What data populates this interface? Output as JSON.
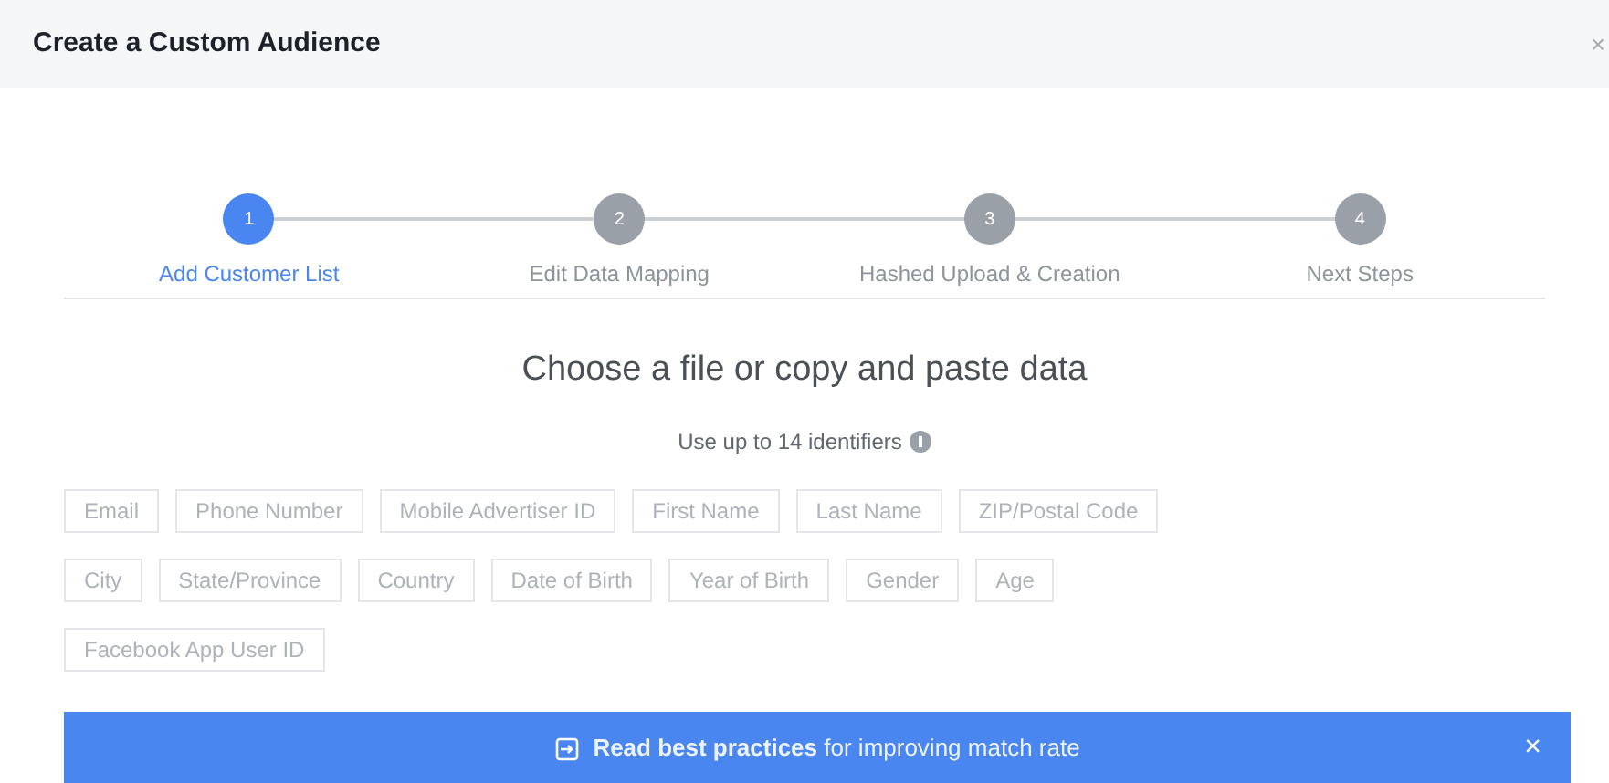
{
  "window": {
    "title": "Create a Custom Audience",
    "close": "×"
  },
  "steps": [
    {
      "number": "1",
      "label": "Add Customer List",
      "selected": true
    },
    {
      "number": "2",
      "label": "Edit Data Mapping",
      "selected": false
    },
    {
      "number": "3",
      "label": "Hashed Upload & Creation",
      "selected": false
    },
    {
      "number": "4",
      "label": "Next Steps",
      "selected": false
    }
  ],
  "heading": "Choose a file or copy and paste data",
  "subheading": "Use up to 14 identifiers",
  "identifier_rows": [
    [
      "Email",
      "Phone Number",
      "Mobile Advertiser ID",
      "First Name",
      "Last Name",
      "ZIP/Postal Code"
    ],
    [
      "City",
      "State/Province",
      "Country",
      "Date of Birth",
      "Year of Birth",
      "Gender",
      "Age"
    ],
    [
      "Facebook App User ID"
    ]
  ],
  "banner": {
    "text": "**Read best practices** for improving match rate",
    "close": "×"
  }
}
